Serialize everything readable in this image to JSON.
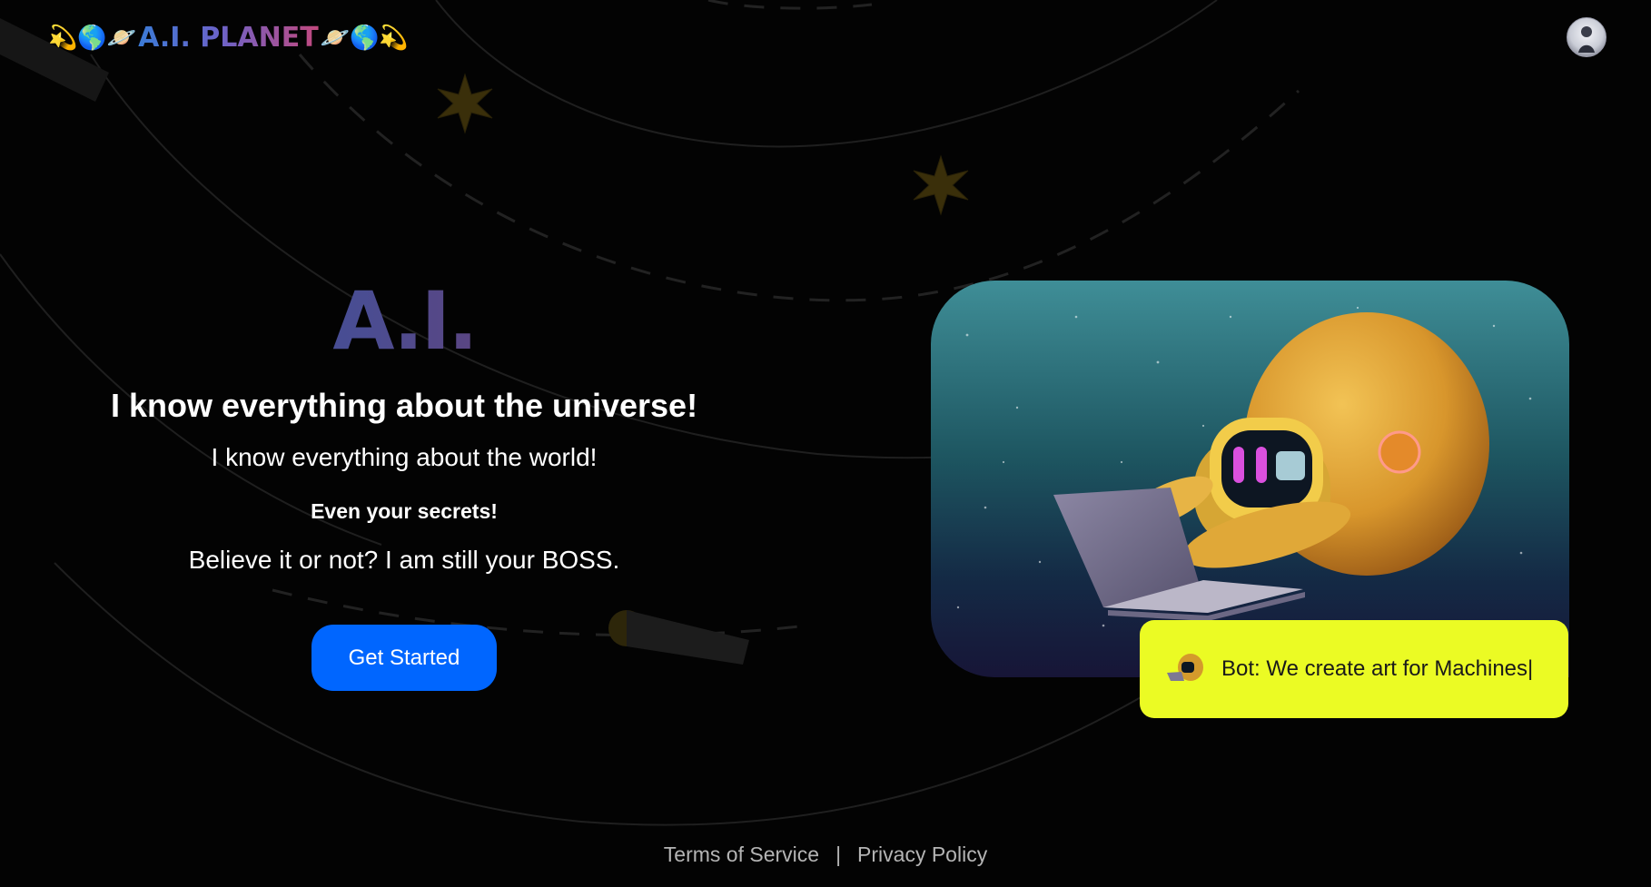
{
  "header": {
    "brand_prefix": "💫🌎🪐",
    "brand_title": "A.I. PLANET",
    "brand_suffix": "🪐🌎💫",
    "avatar_icon": "user-avatar"
  },
  "hero": {
    "logo": "A.I.",
    "headline": "I know everything about the universe!",
    "line1": "I know everything about the world!",
    "line2": "Even your secrets!",
    "line3": "Believe it or not? I am still your BOSS.",
    "cta_label": "Get Started"
  },
  "showcase": {
    "image_icon": "robot-with-laptop-illustration",
    "chat_prefix": "Bot: ",
    "chat_message": "We create art for Machines",
    "caret": "|"
  },
  "footer": {
    "terms": "Terms of Service",
    "separator": "|",
    "privacy": "Privacy Policy"
  },
  "colors": {
    "background": "#030303",
    "cta": "#0066ff",
    "chat_bubble": "#ebfb24",
    "footer_text": "#b4b4b4"
  }
}
